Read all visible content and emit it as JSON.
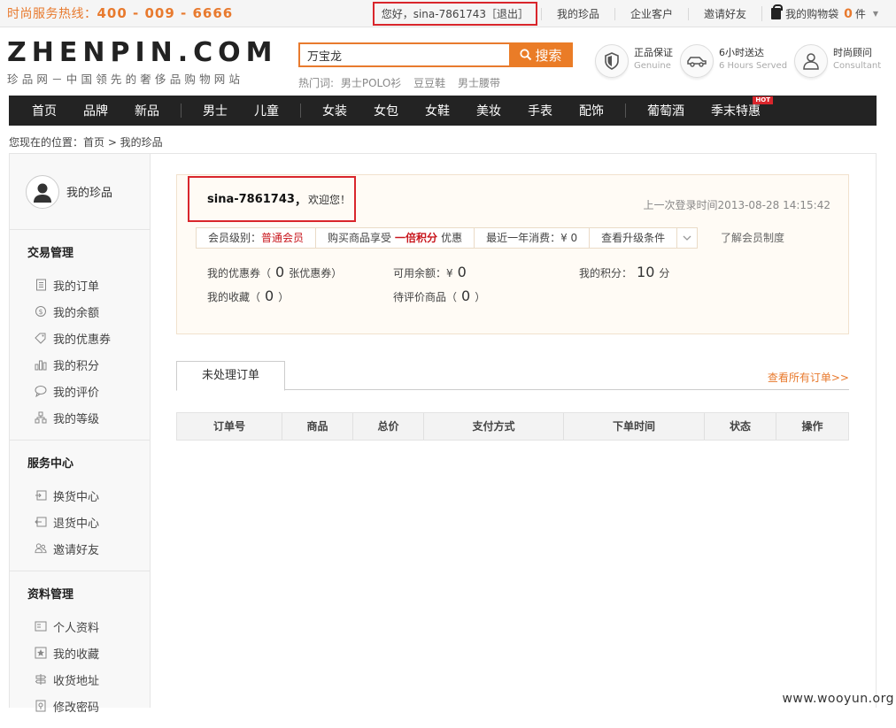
{
  "topbar": {
    "hotline_label": "时尚服务热线：",
    "hotline_number": "400 - 009 - 6666",
    "greeting": "您好，sina-7861743［退出］",
    "links": [
      "我的珍品",
      "企业客户",
      "邀请好友"
    ],
    "cart_label": "我的购物袋",
    "cart_count": "0",
    "cart_unit": "件"
  },
  "logo": {
    "en": "ZHENPIN.COM",
    "cn": "珍品网－中国领先的奢侈品购物网站"
  },
  "search": {
    "value": "万宝龙",
    "button": "搜索",
    "hot_label": "热门词:",
    "hot_words": [
      "男士POLO衫",
      "豆豆鞋",
      "男士腰带"
    ]
  },
  "services": [
    {
      "title": "正品保证",
      "sub": "Genuine",
      "icon": "shield-icon"
    },
    {
      "title": "6小时送达",
      "sub": "6 Hours Served",
      "icon": "car-icon"
    },
    {
      "title": "时尚顾问",
      "sub": "Consultant",
      "icon": "person-icon"
    }
  ],
  "nav": {
    "items": [
      "首页",
      "品牌",
      "新品",
      "男士",
      "儿童",
      "女装",
      "女包",
      "女鞋",
      "美妆",
      "手表",
      "配饰",
      "葡萄酒",
      "季末特惠"
    ],
    "hot_tag": "HOT"
  },
  "breadcrumb": "您现在的位置：首页 > 我的珍品",
  "sidebar": {
    "user_label": "我的珍品",
    "sections": [
      {
        "title": "交易管理",
        "items": [
          "我的订单",
          "我的余额",
          "我的优惠券",
          "我的积分",
          "我的评价",
          "我的等级"
        ]
      },
      {
        "title": "服务中心",
        "items": [
          "换货中心",
          "退货中心",
          "邀请好友"
        ]
      },
      {
        "title": "资料管理",
        "items": [
          "个人资料",
          "我的收藏",
          "收货地址",
          "修改密码"
        ]
      }
    ]
  },
  "welcome": {
    "username": "sina-7861743",
    "comma": "，",
    "hello": "欢迎您！",
    "last_login": "上一次登录时间2013-08-28 14:15:42",
    "member_level_label": "会员级别：",
    "member_level": "普通会员",
    "privilege_pre": "购买商品享受",
    "privilege_value": "一倍积分",
    "privilege_post": "优惠",
    "year_spend": "最近一年消费：¥ 0",
    "upgrade": "查看升级条件",
    "learn_more": "了解会员制度",
    "stats": {
      "coupon_label": "我的优惠券（",
      "coupon_value": "0",
      "coupon_suffix": "张优惠券）",
      "balance_label": "可用余额：¥",
      "balance_value": "0",
      "points_label": "我的积分：",
      "points_value": "10",
      "points_suffix": "分",
      "fav_label": "我的收藏（",
      "fav_value": "0",
      "fav_suffix": "）",
      "review_label": "待评价商品（",
      "review_value": "0",
      "review_suffix": "）"
    }
  },
  "orders": {
    "tab": "未处理订单",
    "view_all": "查看所有订单>>",
    "columns": [
      "订单号",
      "商品",
      "总价",
      "支付方式",
      "下单时间",
      "状态",
      "操作"
    ]
  },
  "watermark": "www.wooyun.org"
}
